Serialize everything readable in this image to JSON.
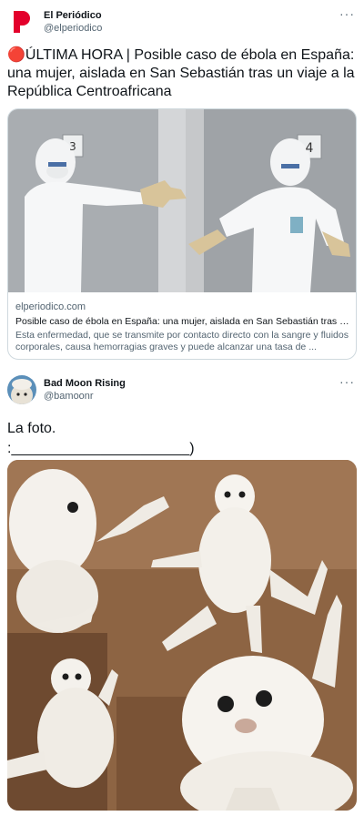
{
  "tweet1": {
    "display_name": "El Periódico",
    "handle": "@elperiodico",
    "more_icon": "more-dots-icon",
    "text": "🔴ÚLTIMA HORA | Posible caso de ébola en España: una mujer, aislada en San Sebastián tras un viaje a la República Centroafricana",
    "card": {
      "domain": "elperiodico.com",
      "title": "Posible caso de ébola en España: una mujer, aislada en San Sebastián tras u...",
      "description": "Esta enfermedad, que se transmite por contacto directo con la sangre y fluidos corporales, causa hemorragias graves y puede alcanzar una tasa de ...",
      "image_labels": {
        "door_left": "3",
        "door_right": "4"
      }
    }
  },
  "tweet2": {
    "display_name": "Bad Moon Rising",
    "handle": "@bamoonr",
    "more_icon": "more-dots-icon",
    "text_line1": "La foto.",
    "text_line2": ":______________________)"
  },
  "colors": {
    "text": "#0f1419",
    "secondary": "#536471",
    "border": "#cfd9de",
    "brand_red": "#e3002b"
  }
}
